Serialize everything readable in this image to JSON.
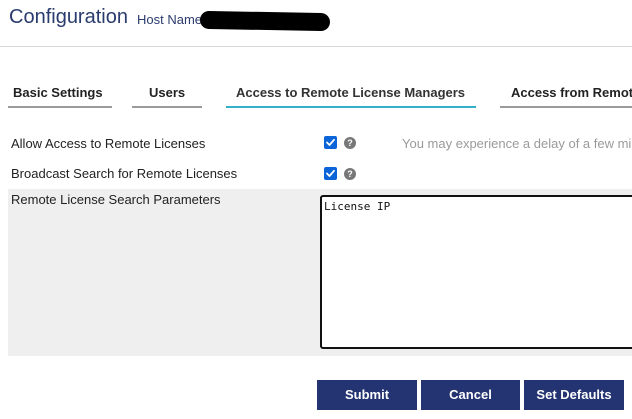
{
  "header": {
    "title": "Configuration",
    "host_label": "Host Name"
  },
  "tabs": [
    {
      "label": "Basic Settings",
      "active": false
    },
    {
      "label": "Users",
      "active": false
    },
    {
      "label": "Access to Remote License Managers",
      "active": true
    },
    {
      "label": "Access from Remot",
      "active": false
    }
  ],
  "settings": {
    "allow_access": {
      "label": "Allow Access to Remote Licenses",
      "checked": true,
      "hint": "You may experience a delay of a few mi"
    },
    "broadcast_search": {
      "label": "Broadcast Search for Remote Licenses",
      "checked": true
    },
    "search_params": {
      "label": "Remote License Search Parameters",
      "value": "License IP"
    }
  },
  "buttons": {
    "submit": "Submit",
    "cancel": "Cancel",
    "set_defaults": "Set Defaults"
  },
  "colors": {
    "title": "#2a3b6e",
    "button_bg": "#243371",
    "active_tab_underline": "#34b0c8",
    "checkbox": "#0b65d8"
  }
}
